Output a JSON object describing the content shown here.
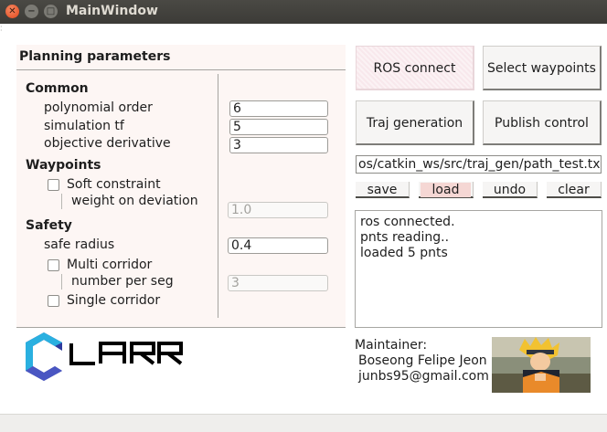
{
  "window": {
    "title": "MainWindow"
  },
  "panel": {
    "heading": "Planning parameters",
    "common": {
      "heading": "Common",
      "poly_order_label": "polynomial order",
      "poly_order_value": "6",
      "sim_tf_label": "simulation tf",
      "sim_tf_value": "5",
      "obj_deriv_label": "objective derivative",
      "obj_deriv_value": "3"
    },
    "waypoints": {
      "heading": "Waypoints",
      "soft_constraint_label": "Soft constraint",
      "soft_constraint_checked": false,
      "weight_label": "weight on deviation",
      "weight_value": "1.0"
    },
    "safety": {
      "heading": "Safety",
      "safe_radius_label": "safe radius",
      "safe_radius_value": "0.4",
      "multi_corridor_label": "Multi corridor",
      "multi_corridor_checked": false,
      "number_per_seg_label": "number per seg",
      "number_per_seg_value": "3",
      "single_corridor_label": "Single corridor",
      "single_corridor_checked": false
    }
  },
  "buttons": {
    "ros_connect": "ROS connect",
    "select_waypoints": "Select waypoints",
    "traj_generation": "Traj generation",
    "publish_control": "Publish control",
    "save": "save",
    "load": "load",
    "undo": "undo",
    "clear": "clear"
  },
  "path_field": {
    "value": "os/catkin_ws/src/traj_gen/path_test.txt"
  },
  "log": {
    "lines": [
      "ros connected.",
      "pnts reading..",
      "loaded 5 pnts"
    ]
  },
  "logo": {
    "text": "LARR"
  },
  "maintainer": {
    "label": "Maintainer:",
    "name": "Boseong Felipe Jeon",
    "email": "junbs95@gmail.com"
  },
  "colors": {
    "titlebar": "#3c3b37",
    "close_button": "#e3461a",
    "panel_background": "#fdf6f4",
    "highlight_pink": "#f5d7d4",
    "logo_cyan": "#2ab0e0",
    "logo_blue": "#2e3a9e"
  },
  "icons": {
    "close": "close-icon",
    "minimize": "minimize-icon",
    "maximize": "maximize-icon"
  }
}
